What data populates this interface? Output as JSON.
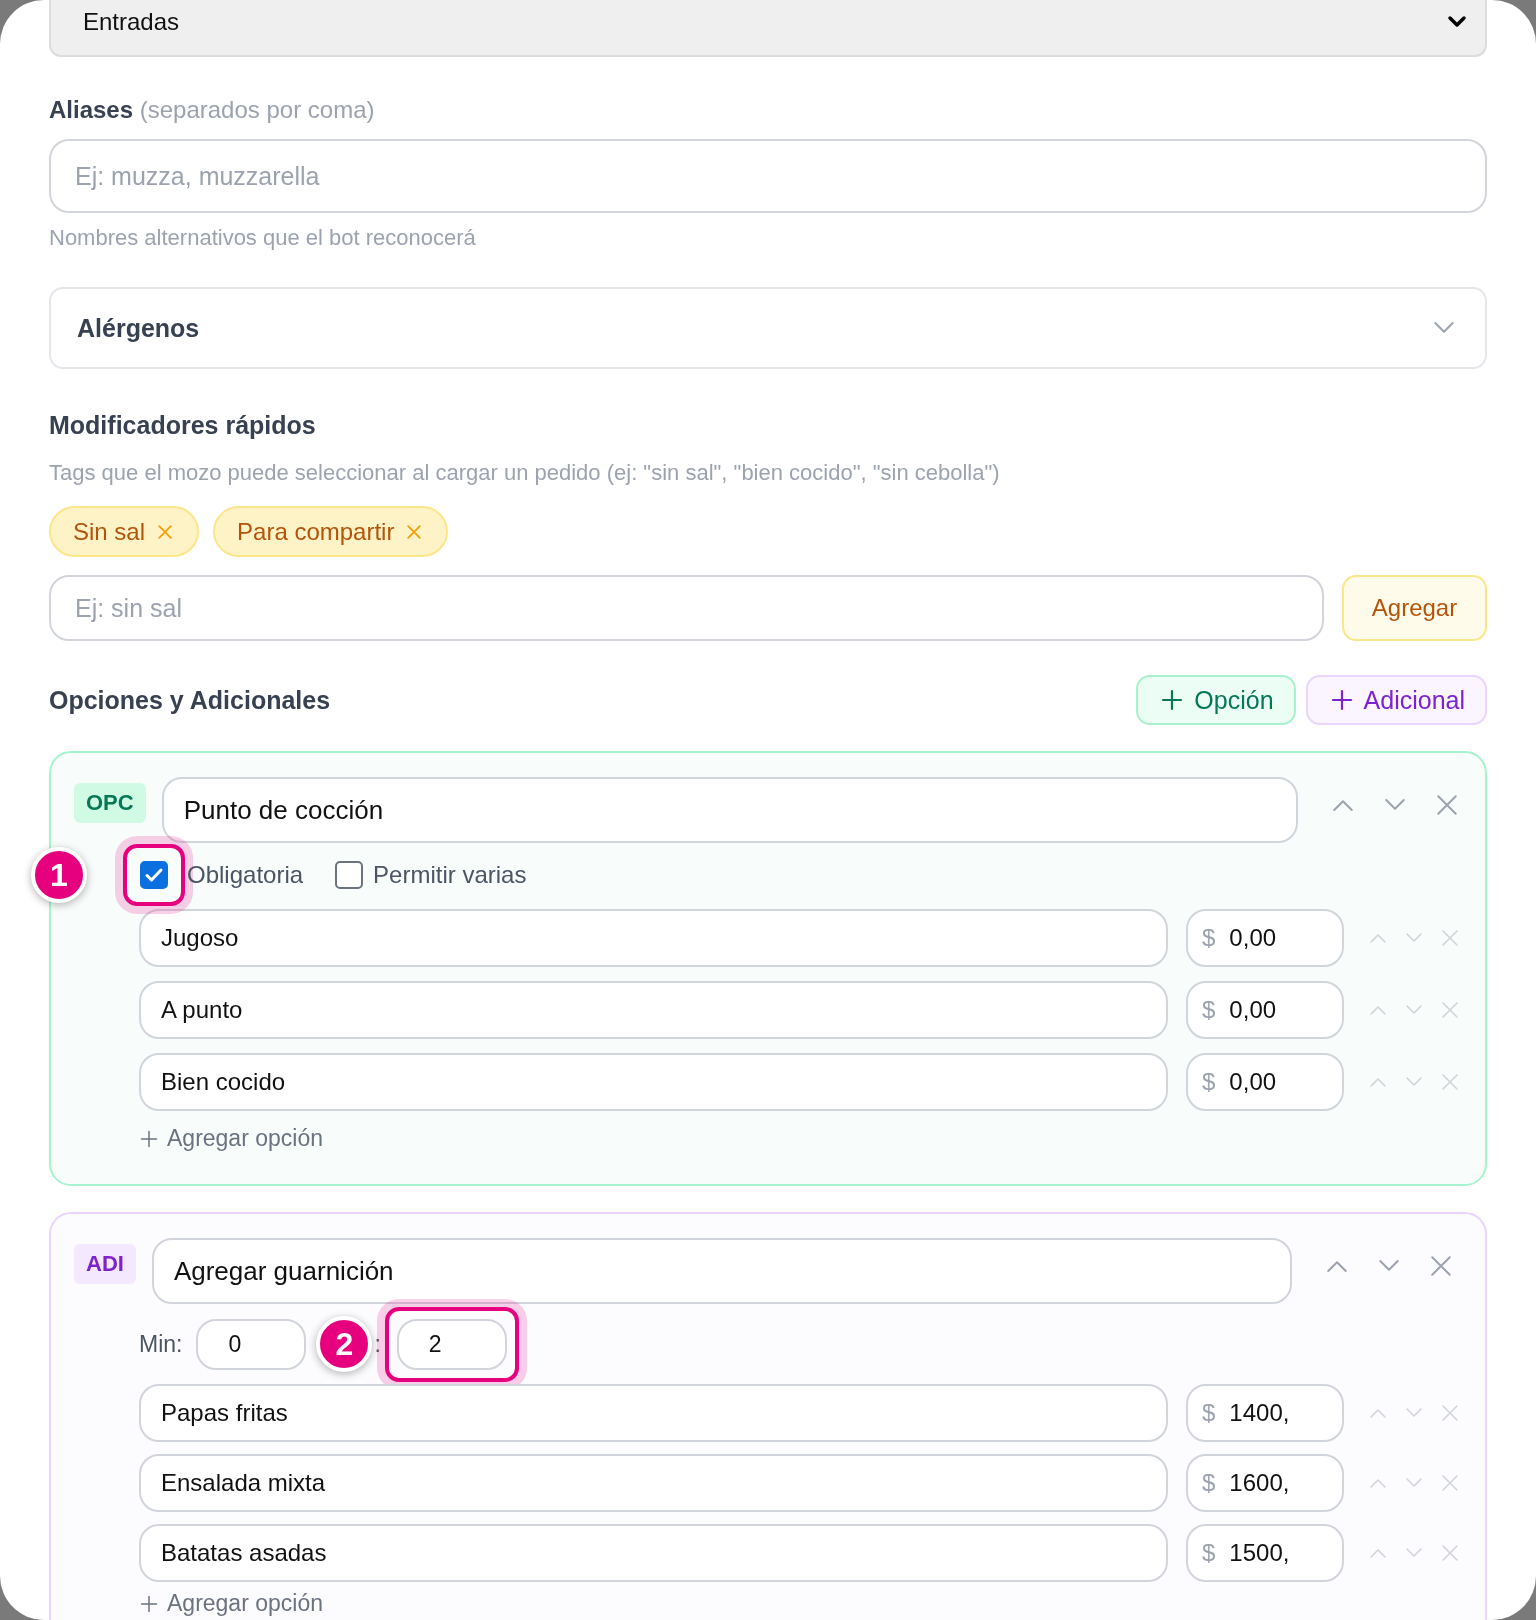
{
  "category_select": {
    "value": "Entradas"
  },
  "aliases": {
    "label": "Aliases",
    "hint": "(separados por coma)",
    "placeholder": "Ej: muzza, muzzarella",
    "help": "Nombres alternativos que el bot reconocerá"
  },
  "allergens": {
    "label": "Alérgenos",
    "expanded": false
  },
  "quick_modifiers": {
    "title": "Modificadores rápidos",
    "description": "Tags que el mozo puede seleccionar al cargar un pedido (ej: \"sin sal\", \"bien cocido\", \"sin cebolla\")",
    "tags": [
      {
        "label": "Sin sal"
      },
      {
        "label": "Para compartir"
      }
    ],
    "input": {
      "placeholder": "Ej: sin sal"
    },
    "add_button": "Agregar"
  },
  "options": {
    "title": "Opciones y Adicionales",
    "buttons": [
      {
        "kind": "option",
        "label": "Opción"
      },
      {
        "kind": "extra",
        "label": "Adicional"
      }
    ],
    "groups": [
      {
        "kind": "option",
        "badge": "OPC",
        "title": "Punto de cocción",
        "checkboxes": [
          {
            "label": "Obligatoria",
            "checked": true,
            "annotation": "1"
          },
          {
            "label": "Permitir varias",
            "checked": false
          }
        ],
        "items": [
          {
            "name": "Jugoso",
            "currency": "$",
            "price": "0,00"
          },
          {
            "name": "A punto",
            "currency": "$",
            "price": "0,00"
          },
          {
            "name": "Bien cocido",
            "currency": "$",
            "price": "0,00"
          }
        ],
        "add_label": "Agregar opción"
      },
      {
        "kind": "extra",
        "badge": "ADI",
        "title": "Agregar guarnición",
        "min_label": "Min:",
        "min": "0",
        "max_label": ":",
        "max": "2",
        "max_annotation": "2",
        "items": [
          {
            "name": "Papas fritas",
            "currency": "$",
            "price": "1400,"
          },
          {
            "name": "Ensalada mixta",
            "currency": "$",
            "price": "1600,"
          },
          {
            "name": "Batatas asadas",
            "currency": "$",
            "price": "1500,"
          }
        ],
        "add_label": "Agregar opción"
      }
    ]
  }
}
